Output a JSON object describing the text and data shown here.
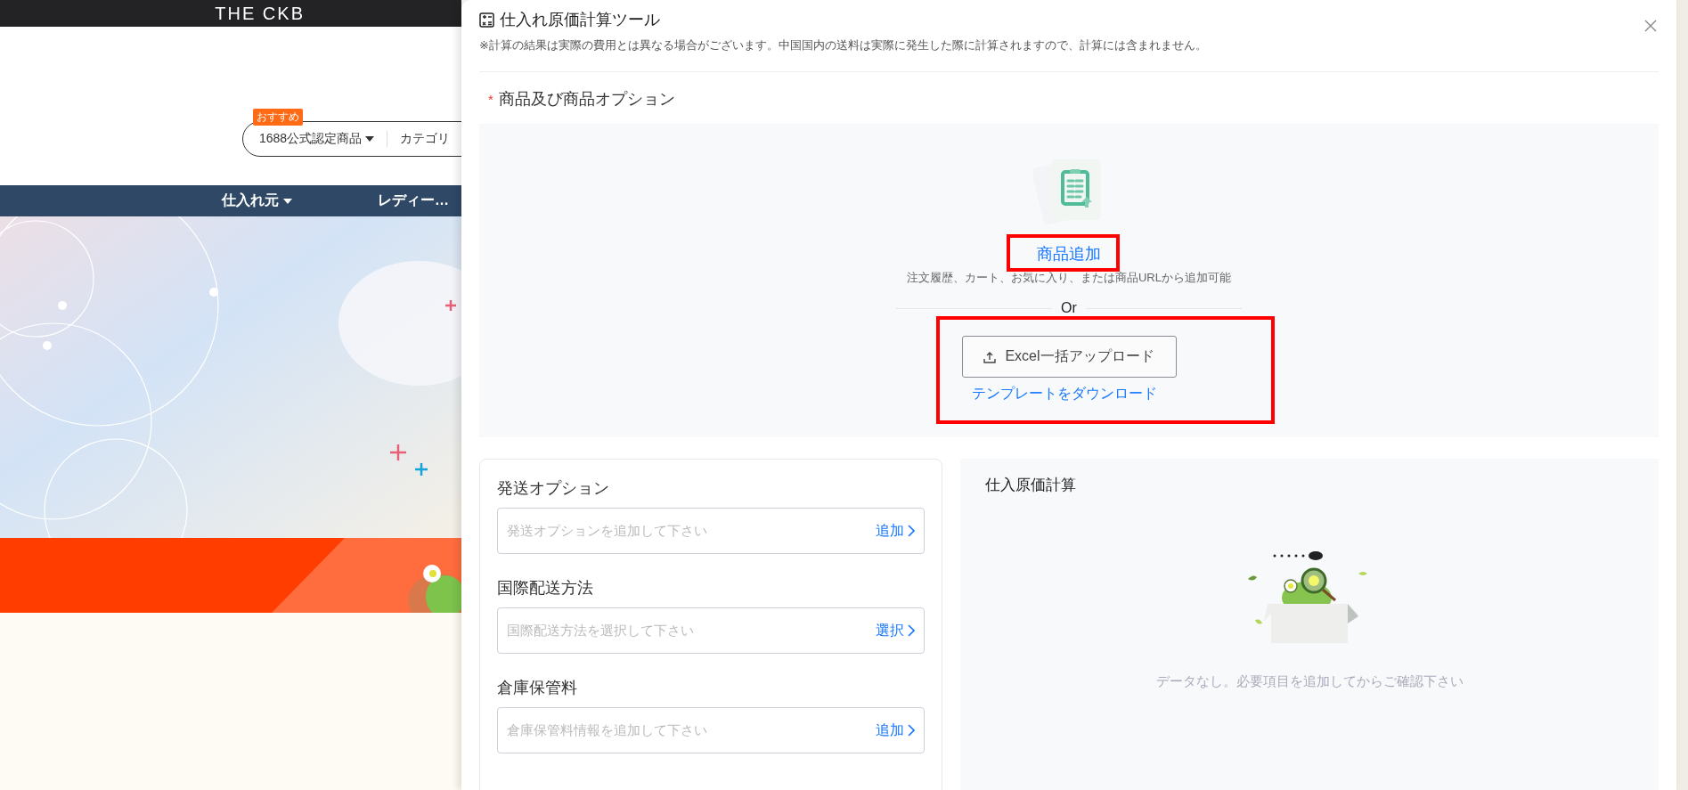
{
  "background_page": {
    "logo": "THE CKB",
    "search": {
      "badge": "おすすめ",
      "scope": "1688公式認定商品",
      "category": "カテゴリ"
    },
    "nav": [
      {
        "label": "仕入れ元",
        "dropdown": true
      },
      {
        "label": "レディー…",
        "dropdown": false
      }
    ]
  },
  "dialog": {
    "title": "仕入れ原価計算ツール",
    "notice": "※計算の結果は実際の費用とは異なる場合がございます。中国国内の送料は実際に発生した際に計算されますので、計算には含まれません。",
    "section": {
      "required_mark": "*",
      "label": "商品及び商品オプション"
    },
    "upload": {
      "add_link": "商品追加",
      "hint": "注文履歴、カート、お気に入り、または商品URLから追加可能",
      "divider": "Or",
      "excel_button": "Excel一括アップロード",
      "template_link": "テンプレートをダウンロード"
    },
    "options": [
      {
        "label": "発送オプション",
        "placeholder": "発送オプションを追加して下さい",
        "action": "追加"
      },
      {
        "label": "国際配送方法",
        "placeholder": "国際配送方法を選択して下さい",
        "action": "選択"
      },
      {
        "label": "倉庫保管料",
        "placeholder": "倉庫保管料情報を追加して下さい",
        "action": "追加"
      }
    ],
    "result": {
      "title": "仕入原価計算",
      "empty_message": "データなし。必要項目を追加してからご確認下さい"
    }
  }
}
